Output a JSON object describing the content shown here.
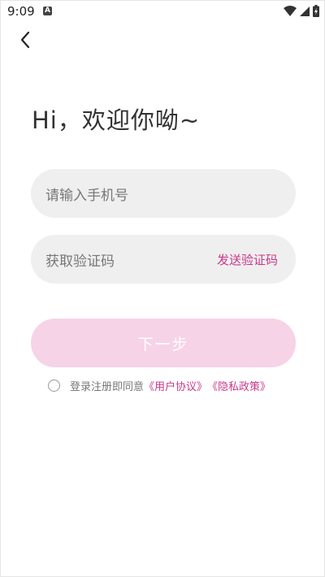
{
  "status_bar": {
    "time": "9:09",
    "notification_icon": "a-icon",
    "icons": [
      "wifi-icon",
      "signal-icon",
      "battery-charging-icon"
    ]
  },
  "header": {
    "back_icon": "chevron-left-icon"
  },
  "greeting": "Hi，欢迎你呦~",
  "phone_field": {
    "placeholder": "请输入手机号"
  },
  "code_field": {
    "placeholder": "获取验证码",
    "send_label": "发送验证码"
  },
  "next_button": {
    "label": "下一步"
  },
  "agreement": {
    "prefix": "登录注册即同意",
    "user_agreement": "《用户协议》",
    "privacy_policy": "《隐私政策》",
    "checked": false
  },
  "colors": {
    "accent": "#c8388a",
    "button_disabled": "#f6d3e7",
    "field_bg": "#efefef"
  }
}
